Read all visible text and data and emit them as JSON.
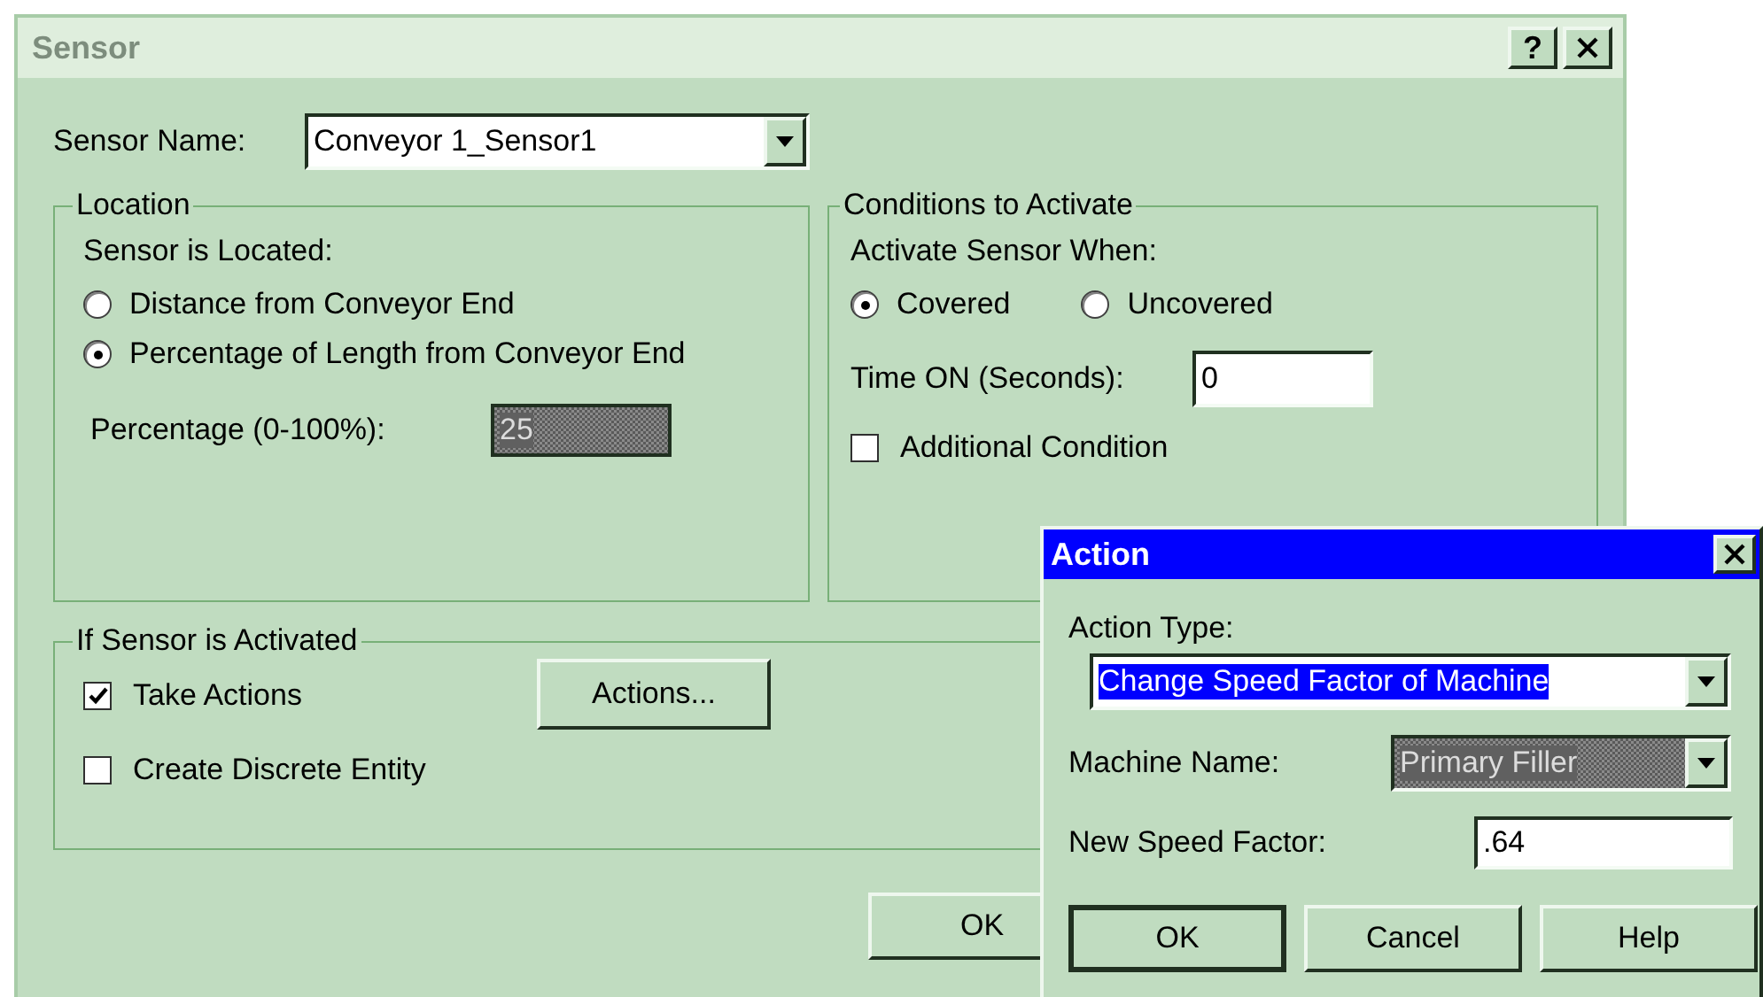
{
  "sensor_dialog": {
    "title": "Sensor",
    "help_button": "?",
    "sensor_name": {
      "label": "Sensor Name:",
      "value": "Conveyor 1_Sensor1"
    },
    "location": {
      "title": "Location",
      "prompt": "Sensor is Located:",
      "options": [
        {
          "label": "Distance from Conveyor End",
          "selected": false
        },
        {
          "label": "Percentage of Length from Conveyor End",
          "selected": true
        }
      ],
      "percentage": {
        "label": "Percentage (0-100%):",
        "value": "25"
      }
    },
    "conditions": {
      "title": "Conditions to Activate",
      "prompt": "Activate Sensor When:",
      "options": [
        {
          "label": "Covered",
          "selected": true
        },
        {
          "label": "Uncovered",
          "selected": false
        }
      ],
      "time_on": {
        "label": "Time ON (Seconds):",
        "value": "0"
      },
      "additional_condition": {
        "label": "Additional Condition",
        "checked": false
      }
    },
    "activated": {
      "title": "If Sensor is Activated",
      "take_actions": {
        "label": "Take Actions",
        "checked": true
      },
      "actions_button": "Actions...",
      "create_entity": {
        "label": "Create Discrete Entity",
        "checked": false
      }
    },
    "buttons": [
      "OK"
    ]
  },
  "action_dialog": {
    "title": "Action",
    "action_type": {
      "label": "Action Type:",
      "value": "Change Speed Factor of Machine"
    },
    "machine_name": {
      "label": "Machine Name:",
      "value": "Primary Filler"
    },
    "speed_factor": {
      "label": "New Speed Factor:",
      "value": ".64"
    },
    "buttons": [
      {
        "label": "OK",
        "default": true
      },
      {
        "label": "Cancel",
        "default": false
      },
      {
        "label": "Help",
        "default": false
      }
    ]
  }
}
